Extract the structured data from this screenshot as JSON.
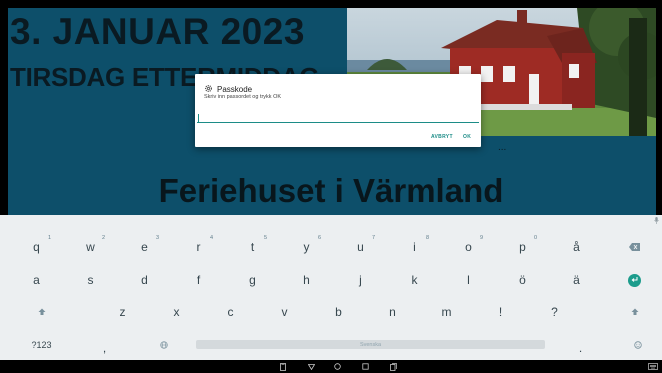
{
  "slide": {
    "date": "3. JANUAR 2023",
    "day": "TIRSDAG ETTERMIDDAG",
    "title": "Feriehuset i Värmland",
    "more": "..."
  },
  "dialog": {
    "title": "Passkode",
    "message": "Skriv inn passordet og trykk OK",
    "input_value": "",
    "cancel_label": "AVBRYT",
    "ok_label": "OK"
  },
  "keyboard": {
    "row1": [
      {
        "key": "q",
        "hint": "1"
      },
      {
        "key": "w",
        "hint": "2"
      },
      {
        "key": "e",
        "hint": "3"
      },
      {
        "key": "r",
        "hint": "4"
      },
      {
        "key": "t",
        "hint": "5"
      },
      {
        "key": "y",
        "hint": "6"
      },
      {
        "key": "u",
        "hint": "7"
      },
      {
        "key": "i",
        "hint": "8"
      },
      {
        "key": "o",
        "hint": "9"
      },
      {
        "key": "p",
        "hint": "0"
      },
      {
        "key": "å",
        "hint": ""
      }
    ],
    "row2": [
      "a",
      "s",
      "d",
      "f",
      "g",
      "h",
      "j",
      "k",
      "l",
      "ö",
      "ä"
    ],
    "row3": [
      "z",
      "x",
      "c",
      "v",
      "b",
      "n",
      "m",
      "!",
      "?"
    ],
    "symbols_label": "?123",
    "comma_label": ",",
    "period_label": ".",
    "space_label": "Svenska"
  },
  "colors": {
    "slide_background": "#0d4f6a",
    "accent": "#1c8c87",
    "keyboard_background": "#eceff1",
    "key_text": "#37474f"
  },
  "icons": [
    "gear-icon",
    "backspace-icon",
    "enter-icon",
    "shift-icon",
    "globe-icon",
    "emoji-icon",
    "mic-icon",
    "keyboard-icon",
    "back-icon",
    "home-icon",
    "recents-icon",
    "screenshot-icon"
  ]
}
